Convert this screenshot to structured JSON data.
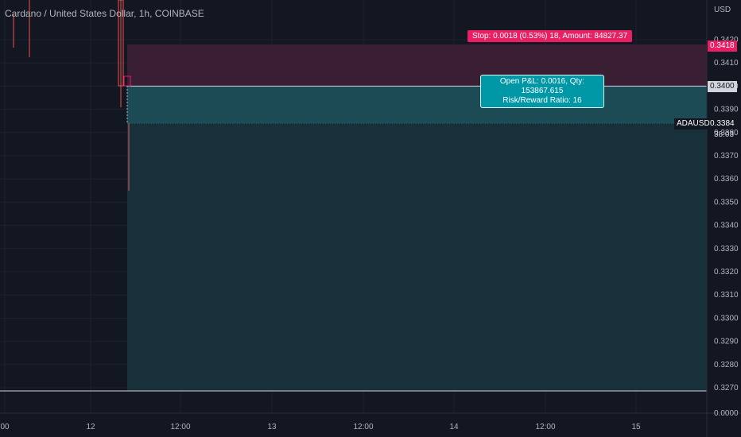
{
  "header": {
    "title": "Cardano / United States Dollar, 1h, COINBASE"
  },
  "price_axis": {
    "currency": "USD"
  },
  "badges": {
    "stop_price": "0.3418",
    "entry_price": "0.3400",
    "current_price": "0.3384",
    "countdown": "38:03",
    "ticker": "ADAUSD"
  },
  "position_tool": {
    "stop_label": "Stop: 0.0018 (0.53%) 18, Amount: 84827.37",
    "pnl_line1": "Open P&L: 0.0016, Qty: 153867.615",
    "pnl_line2": "Risk/Reward Ratio: 16"
  },
  "colors": {
    "background": "#131722",
    "grid": "#1e222d",
    "stop_zone": "#3a1f34",
    "profit_zone": "#17303a",
    "accent_red": "#e91e63",
    "accent_teal": "#0097a7"
  },
  "chart_data": {
    "type": "line",
    "y_ticks": [
      "0.3420",
      "0.3410",
      "0.3400",
      "0.3390",
      "0.3380",
      "0.3370",
      "0.3360",
      "0.3350",
      "0.3340",
      "0.3330",
      "0.3320",
      "0.3310",
      "0.3300",
      "0.3290",
      "0.3280",
      "0.3270",
      "0.0000"
    ],
    "x_ticks": [
      "00",
      "12",
      "12:00",
      "13",
      "12:00",
      "14",
      "12:00",
      "15"
    ],
    "ylim": [
      0.327,
      0.342
    ],
    "levels": {
      "stop": 0.3418,
      "entry": 0.34,
      "current": 0.3384,
      "bottom": 0.327
    }
  }
}
